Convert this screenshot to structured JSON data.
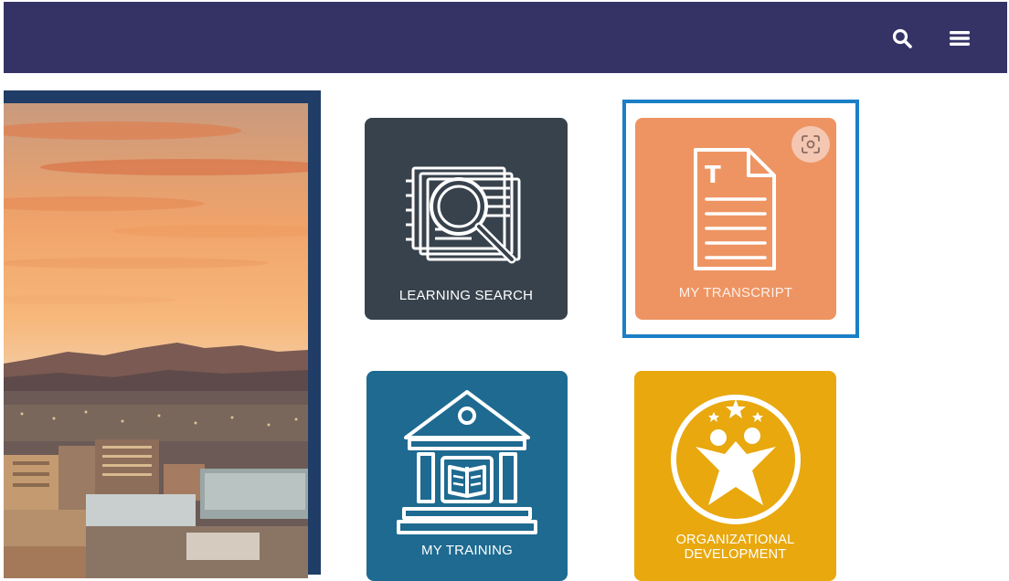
{
  "header": {
    "background": "#353366",
    "search_icon": "search-icon",
    "menu_icon": "hamburger-menu-icon"
  },
  "hero": {
    "description_icon": "city-skyline-sunset-image"
  },
  "tiles": {
    "learning_search": {
      "label": "LEARNING SEARCH",
      "color": "#38424c",
      "icon": "magnifier-over-document-icon"
    },
    "my_transcript": {
      "label": "MY TRANSCRIPT",
      "color": "#ee9462",
      "icon": "document-text-icon",
      "selected": true
    },
    "my_training": {
      "label": "MY TRAINING",
      "color": "#1e6a91",
      "icon": "institution-building-book-icon"
    },
    "organizational_development": {
      "label_line1": "ORGANIZATIONAL",
      "label_line2": "DEVELOPMENT",
      "color": "#e8a80e",
      "icon": "star-people-circle-icon"
    }
  },
  "overlay": {
    "screenshot_icon": "screenshot-capture-icon",
    "selection_color": "#1a7fc7"
  }
}
